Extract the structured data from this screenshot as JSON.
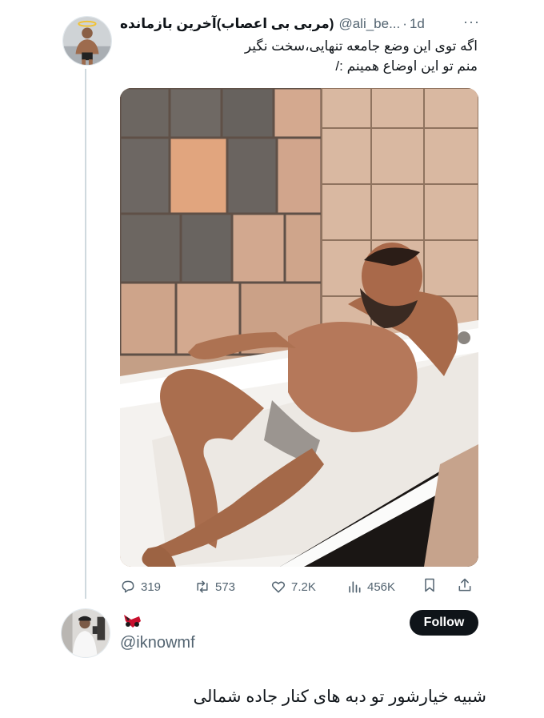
{
  "tweet": {
    "display_name": "(مربی بی اعصاب)آخرین بازمانده",
    "handle": "@ali_be...",
    "separator": "·",
    "time": "1d",
    "more_icon": "more-horizontal-icon",
    "text_lines": [
      "اگه توی این وضع جامعه تنهایی،سخت نگیر",
      "منم تو این اوضاع همینم :/"
    ],
    "stats": {
      "replies": "319",
      "retweets": "573",
      "likes": "7.2K",
      "views": "456K"
    }
  },
  "reply": {
    "handle": "@iknowmf",
    "follow_label": "Follow",
    "text": "شبیه خیارشور تو دبه های کنار جاده شمالی",
    "emoji_icon": "toy-car-icon"
  },
  "colors": {
    "muted": "#536471",
    "text": "#0f1419",
    "follow_bg": "#0f1419",
    "thread_line": "#cfd9de"
  }
}
